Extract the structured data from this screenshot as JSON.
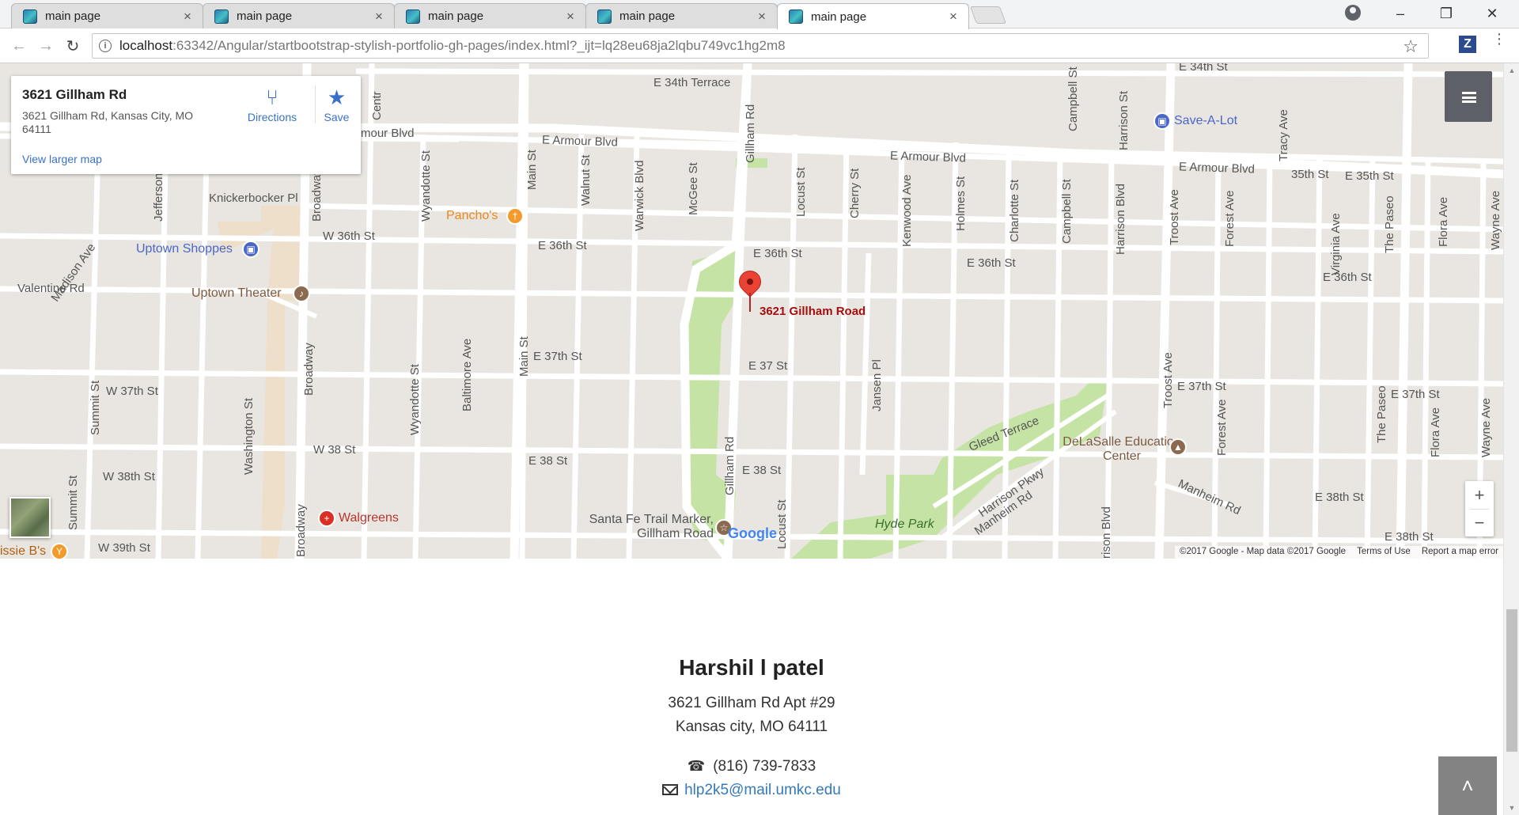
{
  "browser": {
    "tabs": [
      {
        "title": "main page",
        "active": false
      },
      {
        "title": "main page",
        "active": false
      },
      {
        "title": "main page",
        "active": false
      },
      {
        "title": "main page",
        "active": false
      },
      {
        "title": "main page",
        "active": true
      }
    ],
    "tab_close": "×",
    "url_host": "localhost",
    "url_rest": ":63342/Angular/startbootstrap-stylish-portfolio-gh-pages/index.html?_ijt=lq28eu68ja2lqbu749vc1hg2m8",
    "ext_label": "Z"
  },
  "map": {
    "card": {
      "name": "3621 Gillham Rd",
      "address": "3621 Gillham Rd, Kansas City, MO 64111",
      "larger_map": "View larger map",
      "directions": "Directions",
      "save": "Save"
    },
    "marker_label": "3621 Gillham Road",
    "attribution": {
      "copyright": "©2017 Google - Map data ©2017 Google",
      "terms": "Terms of Use",
      "report": "Report a map error"
    },
    "logo": "Google",
    "zoom_in": "+",
    "zoom_out": "−",
    "street_labels": [
      "E 34th Terrace",
      "E 34th St",
      "E Armour Blvd",
      "E Armour Blvd",
      "E Armour Blvd",
      "mour Blvd",
      "35th St",
      "E 35th St",
      "Knickerbocker Pl",
      "W 36th St",
      "E 36th St",
      "E 36th St",
      "E 36th St",
      "E 36th St",
      "Valentine Rd",
      "E 37th St",
      "E 37 St",
      "E 37th St",
      "E 37th St",
      "W 37th St",
      "W 38 St",
      "E 38 St",
      "E 38 St",
      "W 38th St",
      "E 38th St",
      "E 38th St",
      "W 39th St",
      "Gleed Terrace",
      "Harrison Pkwy",
      "Manheim Rd",
      "Manheim Rd",
      "Madison Ave"
    ],
    "vertical_labels": [
      "Summit St",
      "Summit St",
      "Jefferson",
      "Broadway",
      "Broadway",
      "Broadway",
      "Washington St",
      "Wyandotte St",
      "Wyandotte St",
      "Baltimore Ave",
      "Main St",
      "Main St",
      "Walnut St",
      "Warwick Blvd",
      "McGee St",
      "Gillham Rd",
      "Gillham Rd",
      "Locust St",
      "Locust St",
      "Cherry St",
      "Kenwood Ave",
      "Holmes St",
      "Charlotte St",
      "Campbell St",
      "Campbell St",
      "Harrison Blvd",
      "Harrison St",
      "Troost Ave",
      "Troost Ave",
      "Forest Ave",
      "Forest Ave",
      "Tracy Ave",
      "Virginia Ave",
      "The Paseo",
      "The Paseo",
      "Flora Ave",
      "Flora Ave",
      "Wayne Ave",
      "Wayne Ave",
      "Jansen Pl",
      "Centr",
      "rison Blvd"
    ],
    "pois": [
      {
        "name": "Uptown Shoppes",
        "color": "#4a67c7"
      },
      {
        "name": "Uptown Theater",
        "color": "#7c5a40"
      },
      {
        "name": "Pancho's",
        "color": "#e8891c"
      },
      {
        "name": "Walgreens",
        "color": "#d93025"
      },
      {
        "name": "Save-A-Lot",
        "color": "#4a67c7"
      },
      {
        "name": "DeLaSalle Education Center",
        "color": "#7c5a40"
      },
      {
        "name": "Santa Fe Trail Marker, Gillham Road",
        "color": "#7c5a40"
      },
      {
        "name": "Hyde Park",
        "color": "#39702c"
      },
      {
        "name": "issie B's",
        "color": "#e8891c"
      }
    ],
    "colors": {
      "land": "#e9e6e1",
      "park": "#c5e3a5",
      "road": "#ffffff",
      "pin": "#ea4335"
    }
  },
  "contact": {
    "name": "Harshil l patel",
    "address_line1": "3621 Gillham Rd Apt #29",
    "address_line2": "Kansas city, MO 64111",
    "phone": "(816) 739-7833",
    "email": "hlp2k5@mail.umkc.edu"
  }
}
